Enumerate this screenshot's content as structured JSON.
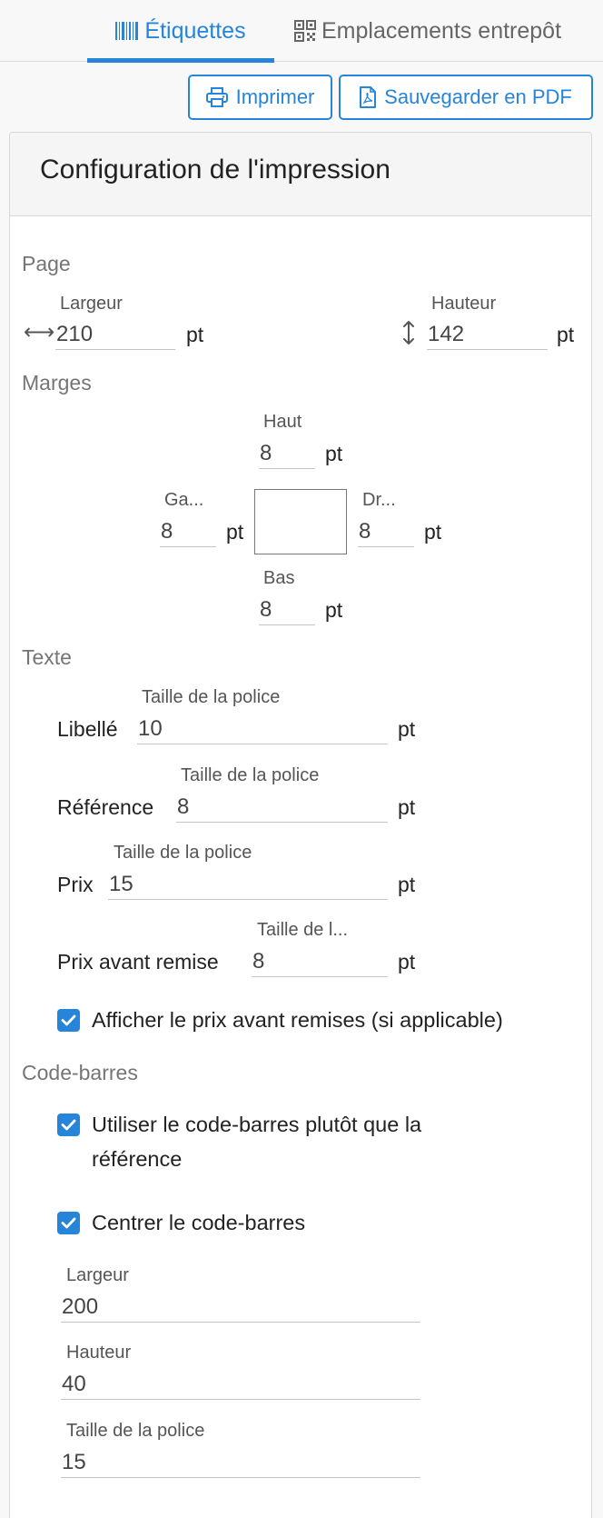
{
  "tabs": [
    {
      "label": "Étiquettes",
      "icon": "barcode-icon",
      "active": true
    },
    {
      "label": "Emplacements entrepôt",
      "icon": "qr-code-icon",
      "active": false
    }
  ],
  "toolbar": {
    "print_label": "Imprimer",
    "pdf_label": "Sauvegarder en PDF"
  },
  "panel": {
    "title": "Configuration de l'impression"
  },
  "page": {
    "section": "Page",
    "width_label": "Largeur",
    "width_value": "210",
    "height_label": "Hauteur",
    "height_value": "142",
    "unit": "pt"
  },
  "margins": {
    "section": "Marges",
    "top_label": "Haut",
    "top_value": "8",
    "left_label": "Ga...",
    "left_value": "8",
    "right_label": "Dr...",
    "right_value": "8",
    "bottom_label": "Bas",
    "bottom_value": "8",
    "unit": "pt"
  },
  "text": {
    "section": "Texte",
    "rows": [
      {
        "label": "Libellé",
        "size_label": "Taille de la police",
        "value": "10"
      },
      {
        "label": "Référence",
        "size_label": "Taille de la police",
        "value": "8"
      },
      {
        "label": "Prix",
        "size_label": "Taille de la police",
        "value": "15"
      },
      {
        "label": "Prix avant remise",
        "size_label": "Taille de l...",
        "value": "8"
      }
    ],
    "unit": "pt",
    "show_before_discount": {
      "label": "Afficher le prix avant remises (si applicable)",
      "checked": true
    }
  },
  "barcode": {
    "section": "Code-barres",
    "use_barcode": {
      "label": "Utiliser le code-barres plutôt que la référence",
      "checked": true
    },
    "center_barcode": {
      "label": "Centrer le code-barres",
      "checked": true
    },
    "width_label": "Largeur",
    "width_value": "200",
    "height_label": "Hauteur",
    "height_value": "40",
    "font_label": "Taille de la police",
    "font_value": "15"
  },
  "colors": {
    "accent": "#2684d9",
    "text": "#222222",
    "muted": "#757575"
  }
}
